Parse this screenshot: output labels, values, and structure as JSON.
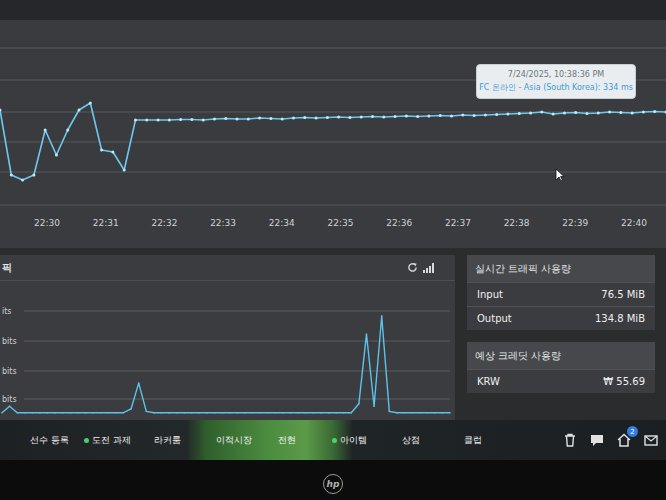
{
  "latency_chart": {
    "x_ticks": [
      "22:30",
      "22:31",
      "22:32",
      "22:33",
      "22:34",
      "22:35",
      "22:36",
      "22:37",
      "22:38",
      "22:39",
      "22:40"
    ],
    "series": [
      {
        "values": [
          340,
          210,
          200,
          210,
          300,
          250,
          300,
          340,
          354,
          260,
          256,
          220,
          320,
          320,
          320,
          320,
          321,
          321,
          320,
          322,
          323,
          322,
          322,
          324,
          323,
          322,
          324,
          325,
          324,
          325,
          326,
          325,
          326,
          327,
          326,
          327,
          328,
          327,
          328,
          329,
          328,
          330,
          329,
          330,
          331,
          332,
          333,
          334,
          336,
          332,
          334,
          335,
          333,
          334,
          336,
          335,
          334,
          336,
          337,
          336
        ]
      }
    ],
    "tooltip": {
      "time": "7/24/2025, 10:38:36 PM",
      "label": "FC 온라인 - Asia (South Korea): 334 ms"
    }
  },
  "traffic_panel": {
    "title": "픽",
    "chart": {
      "y_ticks": [
        "its",
        "bits",
        "bits",
        "bits"
      ],
      "series": [
        {
          "values": [
            0.05,
            0.3,
            0.05,
            0.05,
            0.05,
            0.05,
            0.05,
            0.05,
            0.05,
            0.05,
            0.05,
            0.05,
            0.05,
            0.05,
            0.05,
            0.05,
            0.05,
            0.2,
            1.2,
            0.1,
            0.05,
            0.05,
            0.05,
            0.05,
            0.05,
            0.05,
            0.05,
            0.05,
            0.05,
            0.05,
            0.05,
            0.05,
            0.05,
            0.05,
            0.05,
            0.05,
            0.05,
            0.05,
            0.05,
            0.05,
            0.05,
            0.05,
            0.05,
            0.05,
            0.05,
            0.05,
            0.05,
            0.4,
            3.1,
            0.3,
            3.8,
            0.1,
            0.05,
            0.05,
            0.05,
            0.05,
            0.05,
            0.05,
            0.05,
            0.05
          ]
        }
      ]
    }
  },
  "realtime_usage": {
    "title": "실시간 트래픽 사용량",
    "rows": [
      {
        "label": "Input",
        "value": "76.5 MiB"
      },
      {
        "label": "Output",
        "value": "134.8 MiB"
      }
    ]
  },
  "credit_usage": {
    "title": "예상 크레딧 사용량",
    "rows": [
      {
        "label": "KRW",
        "value": "₩ 55.69"
      }
    ]
  },
  "game_menu": {
    "items": [
      {
        "label": "선수 등록",
        "dot": false
      },
      {
        "label": "도전 과제",
        "dot": true
      },
      {
        "label": "라커룸",
        "dot": false
      },
      {
        "label": "이적시장",
        "dot": false
      },
      {
        "label": "전현",
        "dot": false
      },
      {
        "label": "아이템",
        "dot": true
      },
      {
        "label": "상점",
        "dot": false
      },
      {
        "label": "클럽",
        "dot": false
      }
    ],
    "notification_count": "2"
  },
  "monitor": {
    "brand": "hp"
  }
}
